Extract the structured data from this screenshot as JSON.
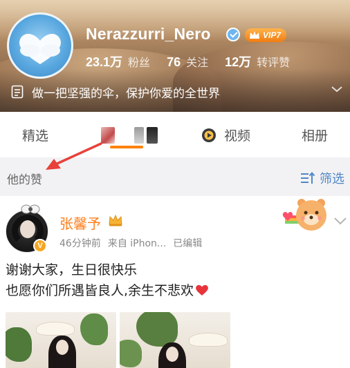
{
  "profile": {
    "username": "Nerazzurri_Nero",
    "vip_label": "VIP7",
    "stats": [
      {
        "value": "23.1万",
        "label": "粉丝"
      },
      {
        "value": "76",
        "label": "关注"
      },
      {
        "value": "12万",
        "label": "转评赞"
      }
    ],
    "bio": "做一把坚强的伞，保护你爱的全世界"
  },
  "tabs": {
    "featured": "精选",
    "video": "视频",
    "album": "相册",
    "active_indicator_color": "#ff8200"
  },
  "filter_bar": {
    "liked_label": "他的赞",
    "filter_label": "筛选"
  },
  "post": {
    "author": "张馨予",
    "author_badge": "V",
    "meta": {
      "time": "46分钟前",
      "source": "来自 iPhon...",
      "edited": "已编辑"
    },
    "text_line1": "谢谢大家，生日很快乐",
    "text_line2": "也愿你们所遇皆良人,余生不悲欢"
  },
  "colors": {
    "accent_orange": "#ff7e1a",
    "link_blue": "#4f87c7",
    "annotation_arrow": "#e8413a"
  },
  "icons": [
    "verified-icon",
    "vip-crown-icon",
    "bio-document-icon",
    "chevron-down-icon",
    "video-icon",
    "filter-icon",
    "heart-emoji-icon",
    "crown-icon"
  ]
}
